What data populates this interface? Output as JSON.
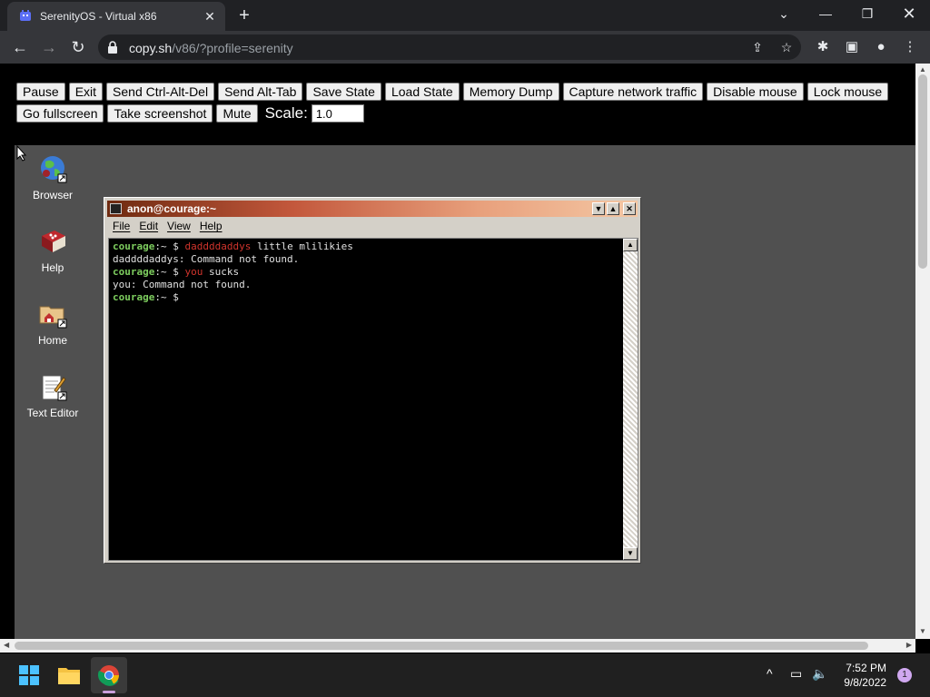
{
  "browser": {
    "tab_title": "SerenityOS - Virtual x86",
    "tab_close": "✕",
    "new_tab": "+",
    "url_host": "copy.sh",
    "url_path": "/v86/?profile=serenity"
  },
  "controls": {
    "row1": [
      "Pause",
      "Exit",
      "Send Ctrl-Alt-Del",
      "Send Alt-Tab",
      "Save State",
      "Load State",
      "Memory Dump",
      "Capture network traffic",
      "Disable mouse",
      "Lock mouse"
    ],
    "row2": [
      "Go fullscreen",
      "Take screenshot",
      "Mute"
    ],
    "scale_label": "Scale:",
    "scale_value": "1.0"
  },
  "desktop": {
    "icons": [
      {
        "label": "Browser",
        "icon": "globe-icon"
      },
      {
        "label": "Help",
        "icon": "book-icon"
      },
      {
        "label": "Home",
        "icon": "folder-icon"
      },
      {
        "label": "Text Editor",
        "icon": "notepad-icon"
      }
    ]
  },
  "terminal": {
    "title": "anon@courage:~",
    "menu": [
      "File",
      "Edit",
      "View",
      "Help"
    ],
    "lines": [
      {
        "host": "courage",
        "prompt": ":~ $ ",
        "cmd": "daddddaddys",
        "rest": " little mlilikies"
      },
      {
        "text": "daddddaddys: Command not found."
      },
      {
        "host": "courage",
        "prompt": ":~ $ ",
        "cmd": "you",
        "rest": " sucks"
      },
      {
        "text": "you: Command not found."
      },
      {
        "host": "courage",
        "prompt": ":~ $ ",
        "cmd": "",
        "rest": ""
      }
    ]
  },
  "taskbar": {
    "time": "7:52 PM",
    "date": "9/8/2022",
    "notifications": "1"
  },
  "colors": {
    "chrome_dark": "#202124",
    "chrome_toolbar": "#35363a",
    "serenity_desktop": "#505050",
    "prompt_green": "#7dcd5e",
    "command_red": "#d0342c"
  }
}
